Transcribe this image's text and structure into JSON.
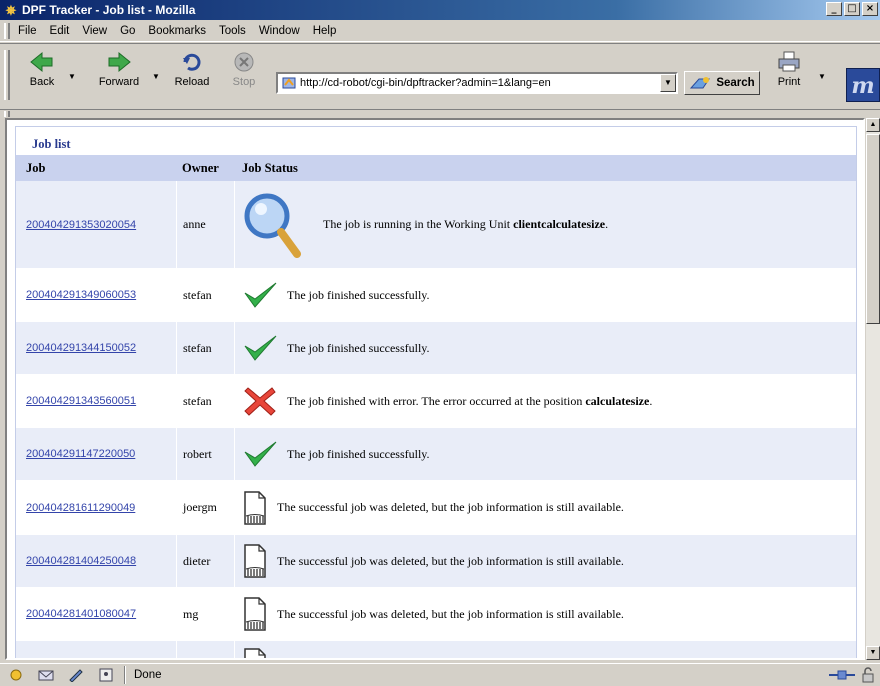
{
  "window": {
    "title": "DPF Tracker - Job list - Mozilla",
    "buttons": [
      "_",
      "□",
      "×"
    ]
  },
  "menu": [
    "File",
    "Edit",
    "View",
    "Go",
    "Bookmarks",
    "Tools",
    "Window",
    "Help"
  ],
  "toolbar": {
    "back": "Back",
    "forward": "Forward",
    "reload": "Reload",
    "stop": "Stop",
    "url": "http://cd-robot/cgi-bin/dpftracker?admin=1&lang=en",
    "search": "Search",
    "print": "Print"
  },
  "page": {
    "panel_title": "Job list",
    "columns": [
      "Job",
      "Owner",
      "Job Status"
    ],
    "rows": [
      {
        "job": "200404291353020054",
        "owner": "anne",
        "icon": "magnifier-icon",
        "status_pre": "The job is running in the Working Unit ",
        "status_bold": "clientcalculatesize",
        "status_post": "."
      },
      {
        "job": "200404291349060053",
        "owner": "stefan",
        "icon": "check-icon",
        "status_pre": "The job finished successfully.",
        "status_bold": "",
        "status_post": ""
      },
      {
        "job": "200404291344150052",
        "owner": "stefan",
        "icon": "check-icon",
        "status_pre": "The job finished successfully.",
        "status_bold": "",
        "status_post": ""
      },
      {
        "job": "200404291343560051",
        "owner": "stefan",
        "icon": "error-x-icon",
        "status_pre": "The job finished with error. The error occurred at the position ",
        "status_bold": "calculatesize",
        "status_post": "."
      },
      {
        "job": "200404291147220050",
        "owner": "robert",
        "icon": "check-icon",
        "status_pre": "The job finished successfully.",
        "status_bold": "",
        "status_post": ""
      },
      {
        "job": "200404281611290049",
        "owner": "joergm",
        "icon": "document-icon",
        "status_pre": "The successful job was deleted, but the job information is still available.",
        "status_bold": "",
        "status_post": ""
      },
      {
        "job": "200404281404250048",
        "owner": "dieter",
        "icon": "document-icon",
        "status_pre": "The successful job was deleted, but the job information is still available.",
        "status_bold": "",
        "status_post": ""
      },
      {
        "job": "200404281401080047",
        "owner": "mg",
        "icon": "document-icon",
        "status_pre": "The successful job was deleted, but the job information is still available.",
        "status_bold": "",
        "status_post": ""
      }
    ]
  },
  "statusbar": {
    "text": "Done"
  },
  "colors": {
    "row_alt": "#e9edf8",
    "header": "#c9d2ee",
    "link": "#3344aa",
    "titlebar": "#0a246a"
  }
}
